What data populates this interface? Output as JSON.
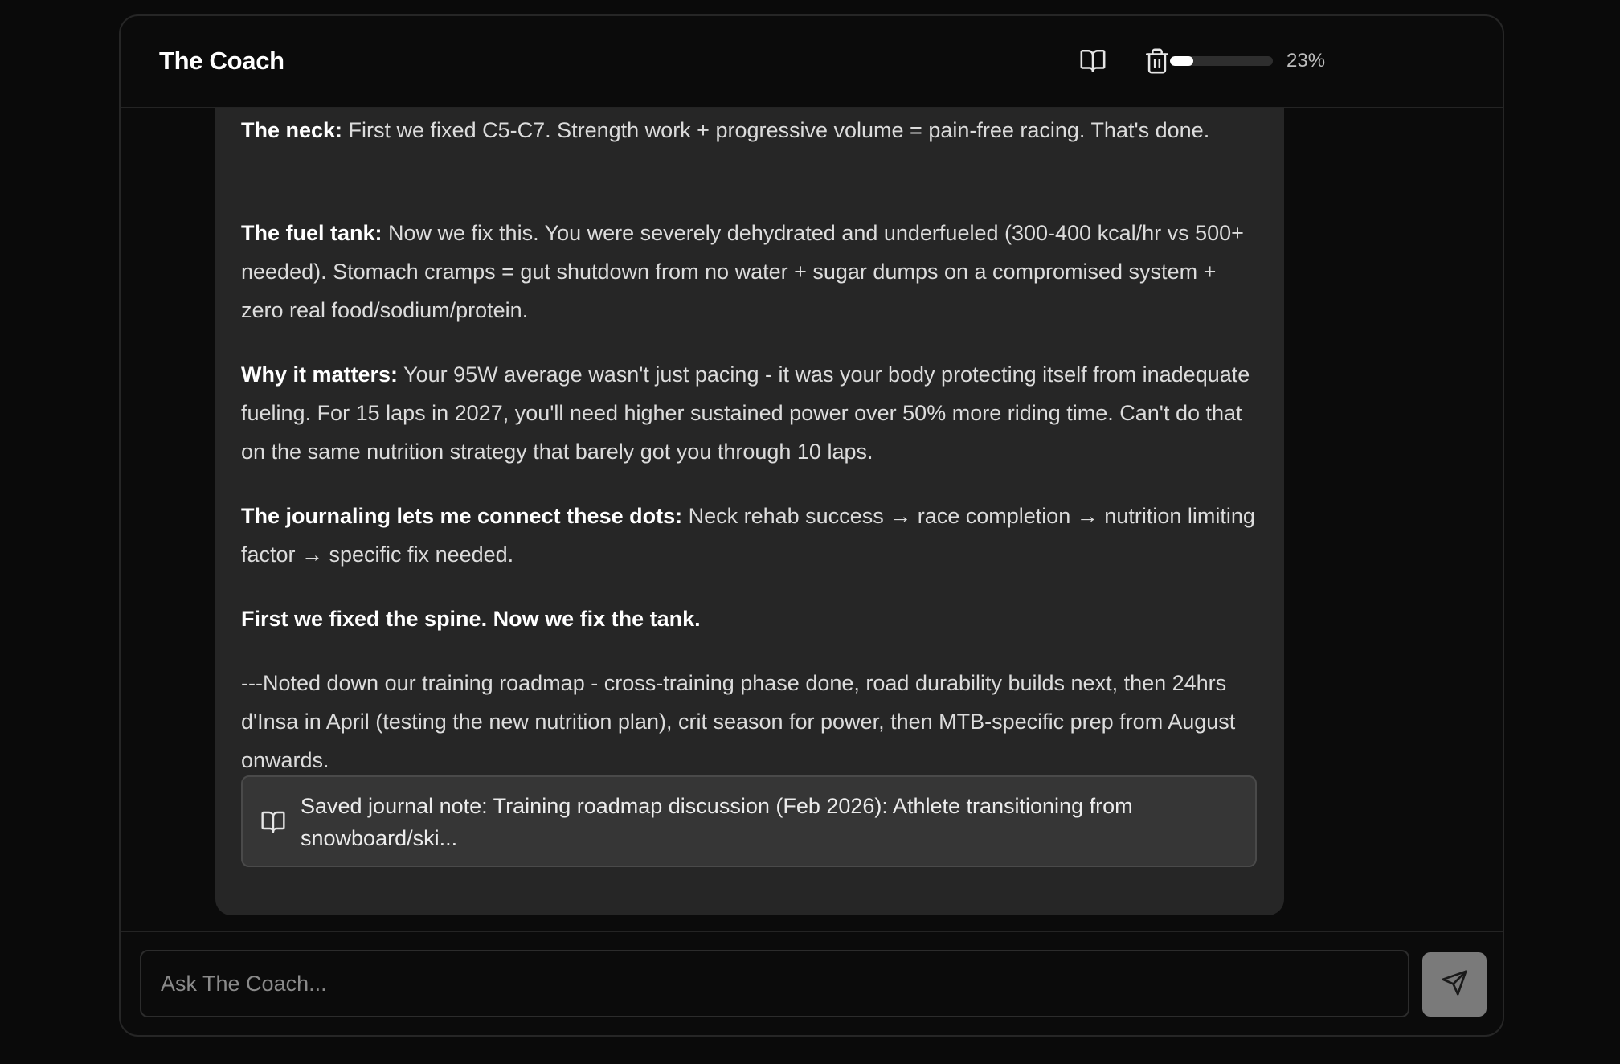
{
  "app": {
    "title": "The Coach"
  },
  "header": {
    "progress_percent": 23,
    "progress_label": "23%",
    "journal_icon": "book-open-icon",
    "delete_icon": "trash-icon"
  },
  "message": {
    "paragraphs": [
      {
        "bold": "The neck:",
        "text": " First we fixed C5-C7. Strength work + progressive volume = pain-free racing. That's done."
      },
      {
        "bold": "The fuel tank:",
        "text": " Now we fix this. You were severely dehydrated and underfueled (300-400 kcal/hr vs 500+ needed). Stomach cramps = gut shutdown from no water + sugar dumps on a compromised system + zero real food/sodium/protein."
      },
      {
        "bold": "Why it matters:",
        "text": " Your 95W average wasn't just pacing - it was your body protecting itself from inadequate fueling. For 15 laps in 2027, you'll need higher sustained power over 50% more riding time. Can't do that on the same nutrition strategy that barely got you through 10 laps."
      },
      {
        "bold": "The journaling lets me connect these dots:",
        "text": " Neck rehab success → race completion → nutrition limiting factor → specific fix needed."
      },
      {
        "bold": "First we fixed the spine. Now we fix the tank.",
        "text": ""
      },
      {
        "bold": "",
        "text": "---Noted down our training roadmap - cross-training phase done, road durability builds next, then 24hrs d'Insa in April (testing the new nutrition plan), crit season for power, then MTB-specific prep from August onwards."
      }
    ],
    "journal_note": {
      "icon": "book-open-icon",
      "text": "Saved journal note: Training roadmap discussion (Feb 2026): Athlete transitioning from snowboard/ski..."
    }
  },
  "composer": {
    "placeholder": "Ask The Coach...",
    "value": "",
    "send_icon": "send-icon"
  },
  "colors": {
    "background": "#0a0a0a",
    "bubble": "#262626",
    "note_card": "#363636",
    "send_button": "#7a7a7a",
    "progress_fill": "#ffffff"
  }
}
